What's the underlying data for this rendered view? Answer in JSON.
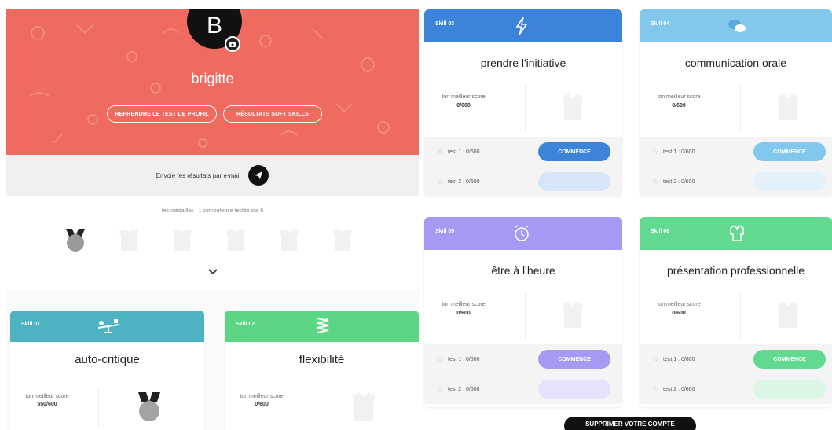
{
  "profile": {
    "initial": "B",
    "username": "brigitte",
    "btn_retake": "Reprendre le test de profil",
    "btn_ranking": "Résultats soft skills"
  },
  "email": {
    "label": "Envoie tes résultats par e-mail"
  },
  "progress": {
    "text": "tes médailles : 1 compétence testée sur 6",
    "earned": 1,
    "total": 6
  },
  "colors": {
    "hero": "#ef6b60",
    "teal": "#4db3c2",
    "green": "#5cd684",
    "blue": "#3b84da",
    "lightblue": "#82c7ec",
    "purple": "#a59af3",
    "mint": "#62d991"
  },
  "left_cards": [
    {
      "tag": "Skill 01",
      "title": "auto-critique",
      "score_label": "ton meilleur score",
      "score": "550/600",
      "icon": "seesaw-icon"
    },
    {
      "tag": "Skill 02",
      "title": "flexibilité",
      "score_label": "ton meilleur score",
      "score": "0/600",
      "icon": "spring-icon"
    }
  ],
  "right_cards": [
    {
      "tag": "Skill 03",
      "title": "prendre l'initiative",
      "score_label": "ton meilleur score",
      "score": "0/600",
      "test1": "test 1 : 0/600",
      "test2": "test 2 : 0/600",
      "begin": "Commence",
      "icon": "lightning-icon"
    },
    {
      "tag": "Skill 04",
      "title": "communication orale",
      "score_label": "ton meilleur score",
      "score": "0/600",
      "test1": "test 1 : 0/600",
      "test2": "test 2 : 0/600",
      "begin": "Commence",
      "icon": "chat-bubbles-icon"
    },
    {
      "tag": "Skill 05",
      "title": "être à l'heure",
      "score_label": "ton meilleur score",
      "score": "0/600",
      "test1": "test 1 : 0/600",
      "test2": "test 2 : 0/600",
      "begin": "Commence",
      "icon": "alarm-clock-icon"
    },
    {
      "tag": "Skill 06",
      "title": "présentation professionnelle",
      "score_label": "ton meilleur score",
      "score": "0/600",
      "test1": "test 1 : 0/600",
      "test2": "test 2 : 0/600",
      "begin": "Commence",
      "icon": "shirt-icon"
    }
  ],
  "delete_account": "Supprimer votre compte"
}
